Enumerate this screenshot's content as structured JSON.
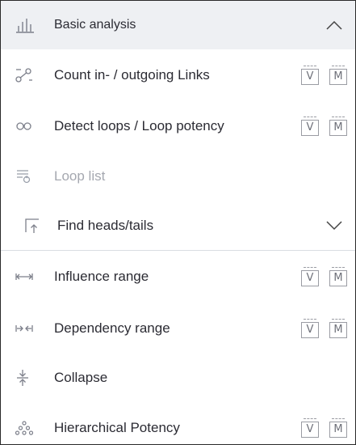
{
  "header": {
    "icon": "bar-chart-icon",
    "title": "Basic analysis",
    "chevron": "chevron-up-icon"
  },
  "items": [
    {
      "icon": "link-nodes-icon",
      "label": "Count in- / outgoing Links",
      "badge_v": "V",
      "badge_m": "M"
    },
    {
      "icon": "infinity-loop-icon",
      "label": "Detect loops / Loop potency",
      "badge_v": "V",
      "badge_m": "M"
    },
    {
      "icon": "list-refresh-icon",
      "label": "Loop list",
      "disabled": true
    },
    {
      "icon": "expand-arrow-icon",
      "label": "Find heads/tails",
      "chevron": "chevron-down-icon"
    },
    {
      "icon": "range-arrows-icon",
      "label": "Influence range",
      "badge_v": "V",
      "badge_m": "M"
    },
    {
      "icon": "dependency-arrows-icon",
      "label": "Dependency range",
      "badge_v": "V",
      "badge_m": "M"
    },
    {
      "icon": "collapse-icon",
      "label": "Collapse"
    },
    {
      "icon": "hierarchy-icon",
      "label": "Hierarchical Potency",
      "badge_v": "V",
      "badge_m": "M"
    }
  ],
  "colors": {
    "header_bg": "#eef0f3",
    "text": "#2b2b33",
    "muted_text": "#a5a8b0",
    "icon": "#7c7f8a"
  }
}
